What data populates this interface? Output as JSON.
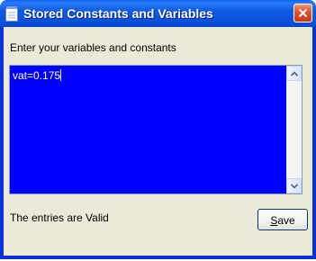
{
  "window": {
    "title": "Stored Constants and Variables"
  },
  "icons": {
    "app": "notepad-icon",
    "close": "close-icon",
    "scroll_up": "chevron-up-icon",
    "scroll_down": "chevron-down-icon"
  },
  "main": {
    "instructions": "Enter your variables and constants",
    "editor": {
      "value": "vat=0.175"
    },
    "status": "The entries are Valid"
  },
  "buttons": {
    "save_mnemonic": "S",
    "save_rest": "ave"
  },
  "colors": {
    "titlebar": "#0851dc",
    "editor_background": "#0000ff",
    "editor_text": "#ffffff",
    "client_background": "#ece9d8",
    "close_button": "#e0502a"
  }
}
